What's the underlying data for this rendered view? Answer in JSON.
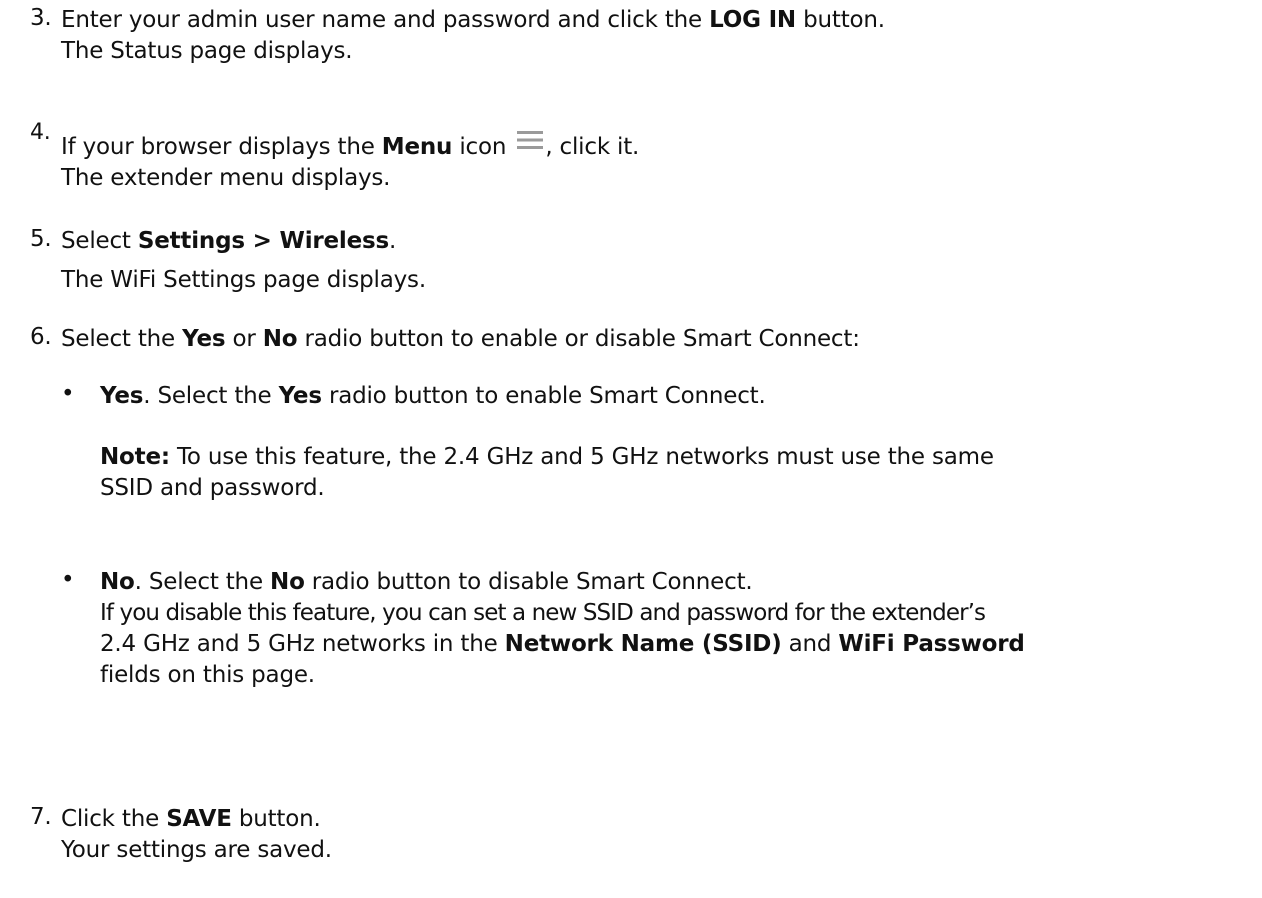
{
  "steps": {
    "s3": {
      "number": "3.",
      "a1": "Enter your admin user name and password and click the ",
      "a_bold": "LOG IN",
      "a2": " button.",
      "b": "The Status page displays."
    },
    "s4": {
      "number": "4.",
      "a1": "If your browser displays the ",
      "a_bold": "Menu",
      "a2": " icon ",
      "a3": ", click it.",
      "icon": "menu-icon",
      "b": "The extender menu displays."
    },
    "s5": {
      "number": "5.",
      "a1": "Select ",
      "a_bold": "Settings > Wireless",
      "a2": ".",
      "b": "The WiFi Settings page displays."
    },
    "s6": {
      "number": "6.",
      "a1": "Select the ",
      "a_bold1": "Yes",
      "a2": " or ",
      "a_bold2": "No",
      "a3": " radio button to enable or disable Smart Connect:"
    },
    "s7": {
      "number": "7.",
      "a1": "Click the ",
      "a_bold": "SAVE",
      "a2": " button.",
      "b": "Your settings are saved."
    }
  },
  "bullets": {
    "yes": {
      "dot": "•",
      "bold1": "Yes",
      "t1": ". Select the ",
      "bold2": "Yes",
      "t2": " radio button to enable Smart Connect."
    },
    "note": {
      "bold": "Note:",
      "t1": "  To use this feature, the 2.4 GHz and 5 GHz networks must use the same",
      "t2": "SSID and password."
    },
    "no": {
      "dot": "•",
      "bold1": "No",
      "t1": ". Select the ",
      "bold2": "No",
      "t2": " radio button to disable Smart Connect.",
      "l2": "If you disable this feature, you can set a new SSID and password for the extender’s",
      "l3a": "2.4 GHz and 5 GHz networks in the ",
      "l3b": "Network Name (SSID)",
      "l3c": " and ",
      "l3d": "WiFi Password",
      "l4": "fields on this page."
    }
  },
  "colors": {
    "text": "#111111",
    "icon": "#9a9a9a"
  }
}
